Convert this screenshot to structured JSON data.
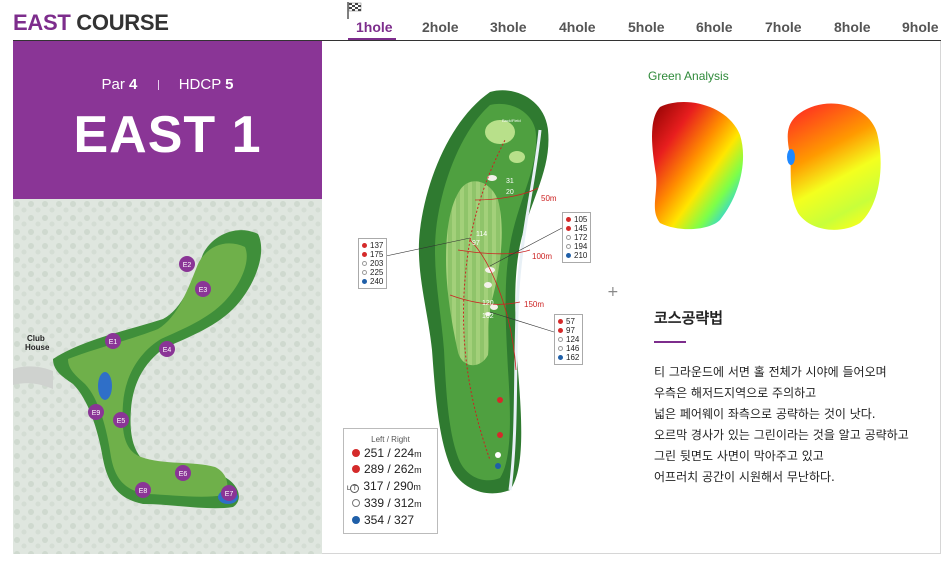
{
  "header": {
    "title_accent": "EAST",
    "title_rest": "COURSE",
    "tabs": [
      "1hole",
      "2hole",
      "3hole",
      "4hole",
      "5hole",
      "6hole",
      "7hole",
      "8hole",
      "9hole"
    ],
    "active_tab": "1hole"
  },
  "info": {
    "par_label": "Par",
    "par_value": "4",
    "hdcp_label": "HDCP",
    "hdcp_value": "5",
    "hole_name": "EAST 1"
  },
  "course_map": {
    "clubhouse_label_1": "Club",
    "clubhouse_label_2": "House",
    "markers": [
      "E1",
      "E2",
      "E3",
      "E4",
      "E5",
      "E6",
      "E7",
      "E8",
      "E9"
    ]
  },
  "hole_map": {
    "green_label": "Back/Field",
    "distance_labels": [
      "50m",
      "100m",
      "150m"
    ],
    "fairway_numbers": [
      "31",
      "20",
      "114",
      "97",
      "120",
      "162"
    ],
    "left_box": [
      "137",
      "175",
      "203",
      "225",
      "240"
    ],
    "right_top_box": [
      "105",
      "145",
      "172",
      "194",
      "210"
    ],
    "right_bottom_box": [
      "57",
      "97",
      "124",
      "146",
      "162"
    ]
  },
  "yardage": {
    "header_left": "Left",
    "header_sep": "/",
    "header_right": "Right",
    "rows": [
      {
        "left": "251",
        "right": "224",
        "unit": "m",
        "color": "#d42a2a"
      },
      {
        "left": "289",
        "right": "262",
        "unit": "m",
        "color": "#d42a2a"
      },
      {
        "left": "317",
        "right": "290",
        "unit": "m",
        "color": "#ffffff"
      },
      {
        "left": "339",
        "right": "312",
        "unit": "m",
        "color": "#ffffff"
      },
      {
        "left": "354",
        "right": "327",
        "unit": "",
        "color": "#1f5fa8"
      }
    ],
    "tee_prefix": "L",
    "tee_icon_label": "T"
  },
  "green_analysis": {
    "title": "Green Analysis"
  },
  "strategy": {
    "title": "코스공략법",
    "lines": [
      "티 그라운드에 서면 홀 전체가 시야에 들어오며",
      "우측은 해저드지역으로 주의하고",
      "넓은 페어웨이 좌측으로 공략하는 것이 낫다.",
      "오르막 경사가 있는 그린이라는 것을 알고 공략하고",
      "그린 뒷면도 사면이 막아주고 있고",
      "어프러치 공간이 시원해서 무난하다."
    ]
  },
  "colors": {
    "brand_purple": "#8a3596",
    "green_title": "#2f8a3a"
  }
}
